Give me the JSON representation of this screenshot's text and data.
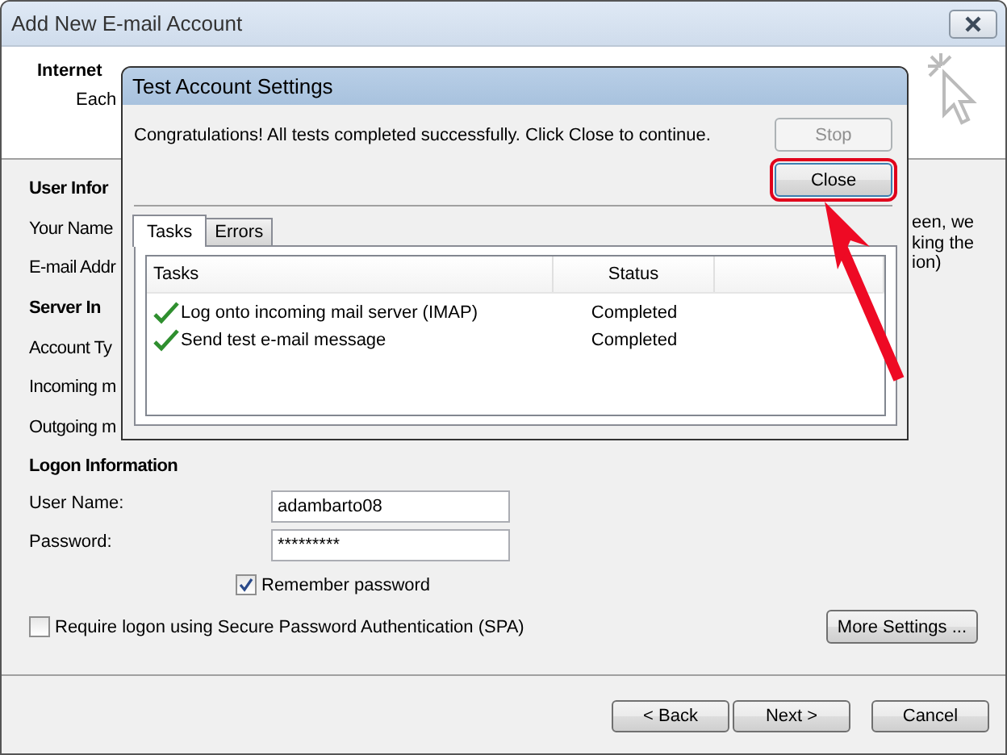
{
  "window": {
    "title": "Add New E-mail Account"
  },
  "header": {
    "title": "Internet",
    "subtitle": "Each"
  },
  "background_labels": [
    {
      "kind": "heading",
      "text": "User Infor"
    },
    {
      "kind": "label",
      "text": "Your Name"
    },
    {
      "kind": "label",
      "text": "E-mail Addr"
    },
    {
      "kind": "heading",
      "text": "Server In"
    },
    {
      "kind": "label",
      "text": "Account Ty"
    },
    {
      "kind": "label",
      "text": "Incoming m"
    },
    {
      "kind": "label",
      "text": "Outgoing m"
    },
    {
      "kind": "heading",
      "text": "Logon Information"
    }
  ],
  "right_note": [
    "een, we",
    "king the",
    "ion)"
  ],
  "logon": {
    "user_name": {
      "label": "User Name:",
      "value": "adambarto08"
    },
    "password": {
      "label": "Password:",
      "value": "*********"
    },
    "remember_password": {
      "label": "Remember password",
      "checked": true
    },
    "spa": {
      "label": "Require logon using Secure Password Authentication (SPA)",
      "checked": false
    },
    "more_settings": "More Settings ..."
  },
  "buttons": [
    "< Back",
    "Next >",
    "Cancel"
  ],
  "dialog": {
    "title": "Test Account Settings",
    "message": "Congratulations! All tests completed successfully. Click Close to continue.",
    "buttons": [
      {
        "label": "Stop",
        "disabled": true,
        "highlighted": false
      },
      {
        "label": "Close",
        "disabled": false,
        "highlighted": true
      }
    ],
    "tabs": [
      {
        "label": "Tasks",
        "selected": true
      },
      {
        "label": "Errors",
        "selected": false
      }
    ],
    "columns": [
      "Tasks",
      "Status"
    ],
    "rows": [
      {
        "task": "Log onto incoming mail server (IMAP)",
        "status": "Completed",
        "done": true
      },
      {
        "task": "Send test e-mail message",
        "status": "Completed",
        "done": true
      }
    ]
  }
}
